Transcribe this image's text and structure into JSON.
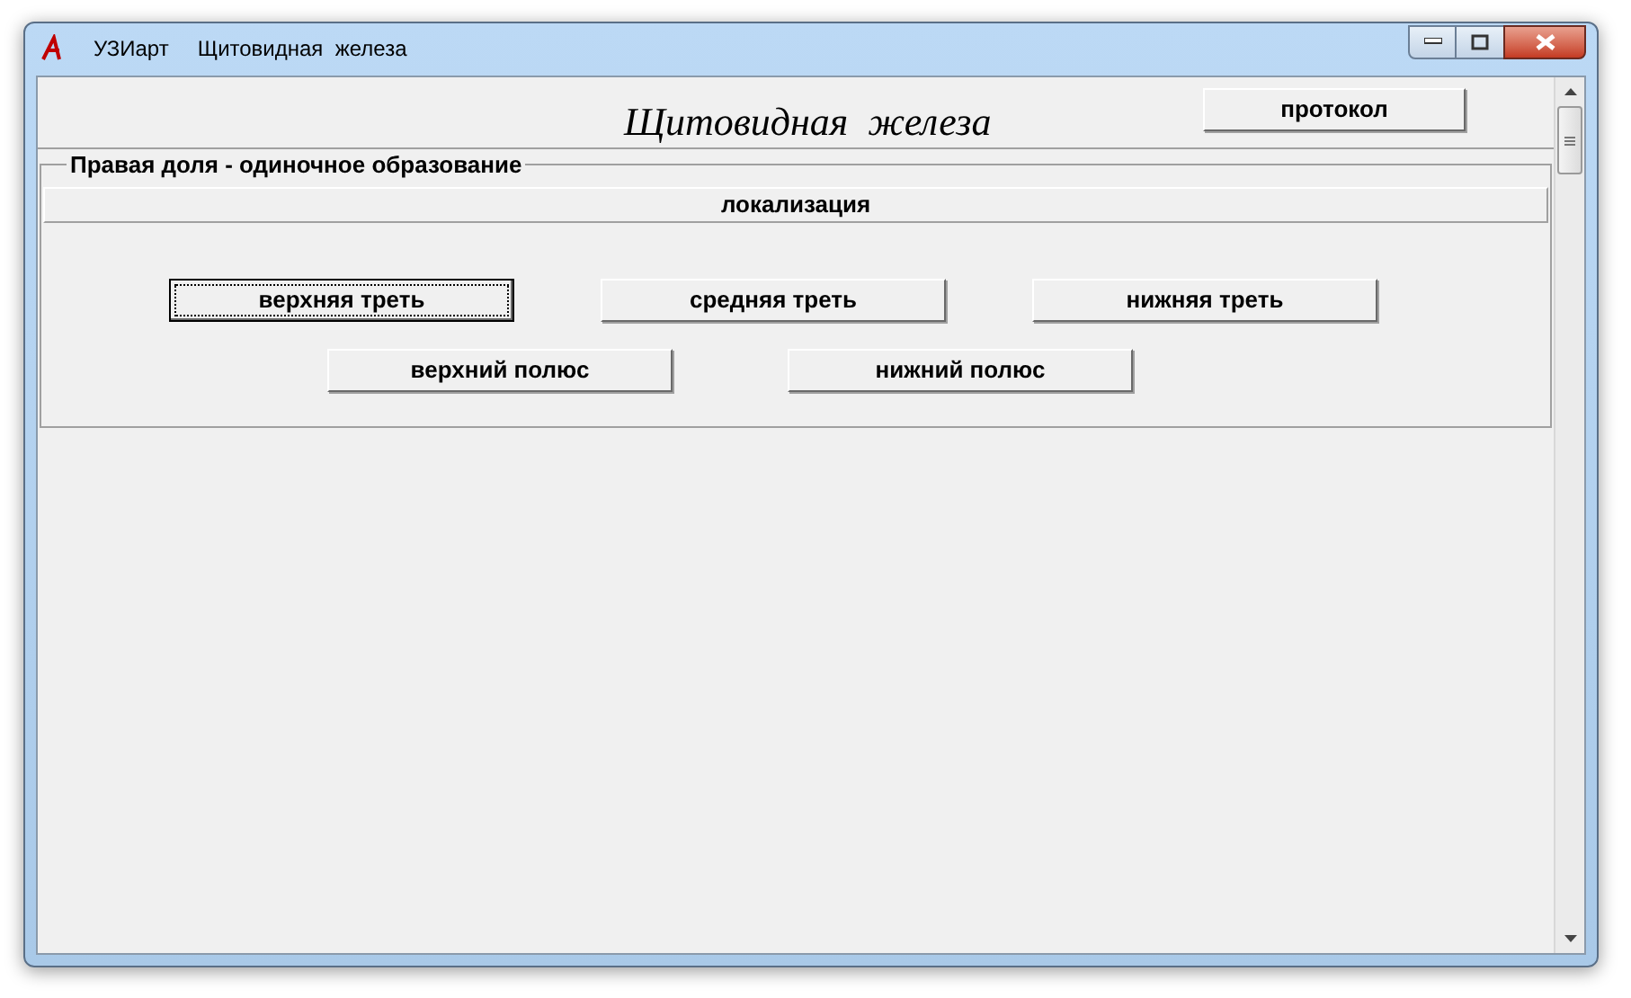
{
  "window": {
    "app": "УЗИарт",
    "title": "Щитовидная  железа"
  },
  "header": {
    "title": "Щитовидная  железа",
    "protocol_button": "протокол"
  },
  "group": {
    "legend": "Правая доля - одиночное образование",
    "section": "локализация",
    "buttons": [
      {
        "label": "верхняя треть",
        "selected": true
      },
      {
        "label": "средняя треть",
        "selected": false
      },
      {
        "label": "нижняя треть",
        "selected": false
      },
      {
        "label": "верхний полюс",
        "selected": false
      },
      {
        "label": "нижний полюс",
        "selected": false
      }
    ]
  }
}
